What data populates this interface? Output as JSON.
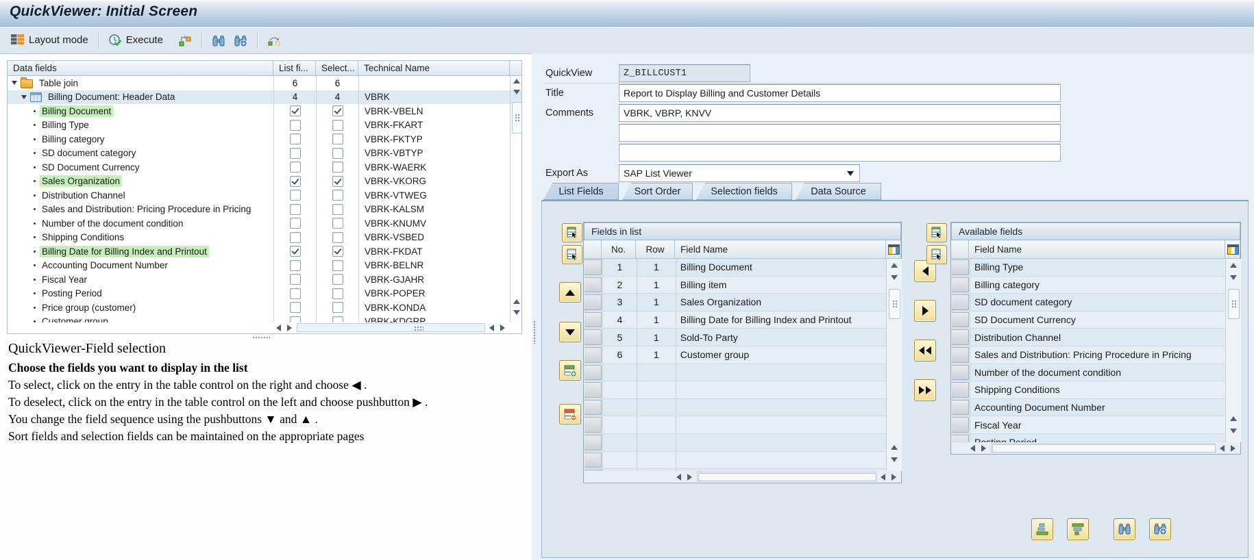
{
  "window": {
    "title": "QuickViewer: Initial Screen"
  },
  "colors": {
    "highlight_green": "#c7efba",
    "button_yellow": "#f1dd96",
    "titlebar_blue": "#a5c1da",
    "panel_blue": "#dde8f1"
  },
  "icons": {
    "layout_mode": "grid-table-icon",
    "execute": "clock-check-icon",
    "display_mode": "green-orange-swap-icon",
    "find": "binoculars-icon",
    "find_next": "binoculars-plus-icon",
    "table_link": "linked-squares-icon",
    "copy_to_list": "table-cursor-icon",
    "sort_asc": "bars-ascending-icon",
    "sort_desc": "bars-descending-icon"
  },
  "toolbar": {
    "layout_mode_label": "Layout mode",
    "execute_label": "Execute"
  },
  "tree_panel": {
    "columns": {
      "data_fields": "Data fields",
      "list_field": "List fi...",
      "selection": "Select...",
      "technical_name": "Technical Name"
    },
    "rows": [
      {
        "label": "Table join",
        "type": "folder",
        "list": "6",
        "sel": "6",
        "tech": ""
      },
      {
        "label": "Billing Document: Header Data",
        "type": "table",
        "list": "4",
        "sel": "4",
        "tech": "VBRK"
      },
      {
        "label": "Billing Document",
        "type": "field",
        "checked": true,
        "highlight": true,
        "tech": "VBRK-VBELN"
      },
      {
        "label": "Billing Type",
        "type": "field",
        "checked": false,
        "highlight": false,
        "tech": "VBRK-FKART"
      },
      {
        "label": "Billing category",
        "type": "field",
        "checked": false,
        "highlight": false,
        "tech": "VBRK-FKTYP"
      },
      {
        "label": "SD document category",
        "type": "field",
        "checked": false,
        "highlight": false,
        "tech": "VBRK-VBTYP"
      },
      {
        "label": "SD Document Currency",
        "type": "field",
        "checked": false,
        "highlight": false,
        "tech": "VBRK-WAERK"
      },
      {
        "label": "Sales Organization",
        "type": "field",
        "checked": true,
        "highlight": true,
        "tech": "VBRK-VKORG"
      },
      {
        "label": "Distribution Channel",
        "type": "field",
        "checked": false,
        "highlight": false,
        "tech": "VBRK-VTWEG"
      },
      {
        "label": "Sales and Distribution: Pricing Procedure in Pricing",
        "type": "field",
        "checked": false,
        "highlight": false,
        "tech": "VBRK-KALSM"
      },
      {
        "label": "Number of the document condition",
        "type": "field",
        "checked": false,
        "highlight": false,
        "tech": "VBRK-KNUMV"
      },
      {
        "label": "Shipping Conditions",
        "type": "field",
        "checked": false,
        "highlight": false,
        "tech": "VBRK-VSBED"
      },
      {
        "label": "Billing Date for Billing Index and Printout",
        "type": "field",
        "checked": true,
        "highlight": true,
        "tech": "VBRK-FKDAT"
      },
      {
        "label": "Accounting Document Number",
        "type": "field",
        "checked": false,
        "highlight": false,
        "tech": "VBRK-BELNR"
      },
      {
        "label": "Fiscal Year",
        "type": "field",
        "checked": false,
        "highlight": false,
        "tech": "VBRK-GJAHR"
      },
      {
        "label": "Posting Period",
        "type": "field",
        "checked": false,
        "highlight": false,
        "tech": "VBRK-POPER"
      },
      {
        "label": "Price group (customer)",
        "type": "field",
        "checked": false,
        "highlight": false,
        "tech": "VBRK-KONDA"
      },
      {
        "label": "Customer group",
        "type": "field",
        "checked": false,
        "highlight": false,
        "tech": "VBRK-KDGRP"
      }
    ]
  },
  "help": {
    "title": "QuickViewer-Field selection",
    "subtitle": "Choose the fields you want to display in the list",
    "line1": "To select, click on the entry in the table control on the right and choose ◀ .",
    "line2": "To deselect, click on the entry in the table control on the left and choose pushbutton ▶ .",
    "line3": "You change the field sequence using the pushbuttons ▼ and ▲ .",
    "line4": "Sort fields and selection fields can be maintained on the appropriate pages"
  },
  "form": {
    "quickview_label": "QuickView",
    "quickview_value": "Z_BILLCUST1",
    "title_label": "Title",
    "title_value": "Report to Display Billing and Customer Details",
    "comments_label": "Comments",
    "comments_value": "VBRK, VBRP, KNVV",
    "extra_value_1": "",
    "extra_value_2": "",
    "export_label": "Export As",
    "export_value": "SAP List Viewer"
  },
  "tabs": [
    "List Fields",
    "Sort Order",
    "Selection fields",
    "Data Source"
  ],
  "fields_in_list": {
    "caption": "Fields in list",
    "columns": [
      "No.",
      "Row",
      "Field Name"
    ],
    "rows": [
      {
        "no": "1",
        "row": "1",
        "name": "Billing Document"
      },
      {
        "no": "2",
        "row": "1",
        "name": "Billing item"
      },
      {
        "no": "3",
        "row": "1",
        "name": "Sales Organization"
      },
      {
        "no": "4",
        "row": "1",
        "name": "Billing Date for Billing Index and Printout"
      },
      {
        "no": "5",
        "row": "1",
        "name": "Sold-To Party"
      },
      {
        "no": "6",
        "row": "1",
        "name": "Customer group"
      }
    ],
    "empty_rows": 7
  },
  "available_fields": {
    "caption": "Available fields",
    "column": "Field Name",
    "rows": [
      "Billing Type",
      "Billing category",
      "SD document category",
      "SD Document Currency",
      "Distribution Channel",
      "Sales and Distribution: Pricing Procedure in Pricing",
      "Number of the document condition",
      "Shipping Conditions",
      "Accounting Document Number",
      "Fiscal Year",
      "Posting Period"
    ]
  }
}
